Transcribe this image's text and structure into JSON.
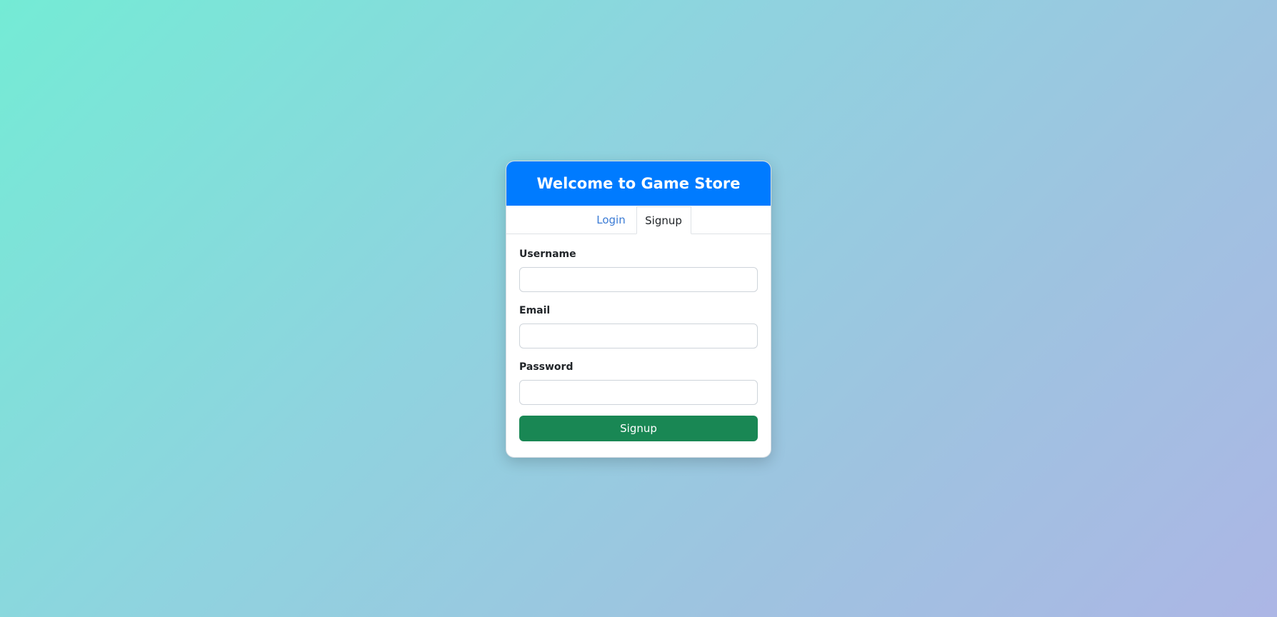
{
  "header": {
    "title": "Welcome to Game Store"
  },
  "tabs": [
    {
      "label": "Login",
      "active": false
    },
    {
      "label": "Signup",
      "active": true
    }
  ],
  "form": {
    "fields": [
      {
        "label": "Username",
        "value": "",
        "placeholder": ""
      },
      {
        "label": "Email",
        "value": "",
        "placeholder": ""
      },
      {
        "label": "Password",
        "value": "",
        "placeholder": ""
      }
    ],
    "submit_label": "Signup"
  },
  "colors": {
    "header_bg": "#007bff",
    "submit_bg": "#198754",
    "tab_link": "#3a7bd5",
    "background_start": "#74ebd5",
    "background_end": "#acb6e5"
  }
}
